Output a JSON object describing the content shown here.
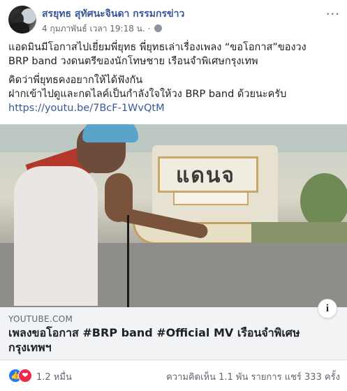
{
  "post": {
    "author": "สรยุทธ สุทัศนะจินดา กรรมกรข่าว",
    "timestamp": "4 กุมภาพันธ์ เวลา 19:18 น.",
    "separator": "·",
    "audience_icon": "globe-icon",
    "more_icon": "more-options-icon",
    "more_glyph": "···",
    "text": {
      "line1": "แอดมินมีโอกาสไปเยี่ยมพี่ยุทธ พี่ยุทธเล่าเรื่องเพลง “ขอโอกาส”ของวง",
      "line2": "BRP band วงดนตรีของนักโทษชาย เรือนจำพิเศษกรุงเทพ",
      "line3": "คิดว่าพี่ยุทธคงอยากให้ได้ฟังกัน",
      "line4": "ฝากเข้าไปดูและกดไลค์เป็นกำลังใจให้วง BRP band ด้วยนะครับ",
      "link": "https://youtu.be/7BcF-1WvQtM"
    }
  },
  "video_sign": "แดนจ",
  "preview": {
    "domain": "YOUTUBE.COM",
    "title_line1": "เพลงขอโอกาส #BRP band #Official MV เรือนจำพิเศษ",
    "title_line2": "กรุงเทพฯ",
    "info_glyph": "i"
  },
  "footer": {
    "reaction_icons": [
      "like-icon",
      "love-icon"
    ],
    "reaction_count": "1.2 หมื่น",
    "stats": "ความคิดเห็น 1.1 พัน รายการ  แชร์ 333 ครั้ง"
  },
  "colors": {
    "author": "#385898",
    "like": "#2078f4",
    "love": "#f0284a"
  }
}
